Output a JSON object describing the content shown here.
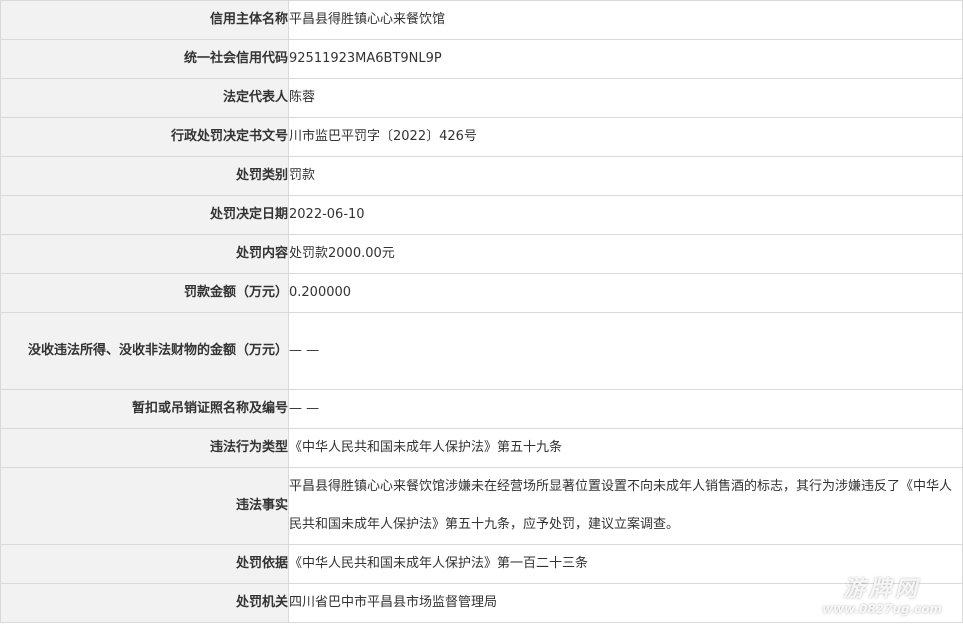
{
  "rows": [
    {
      "label": "信用主体名称",
      "value": "平昌县得胜镇心心来餐饮馆"
    },
    {
      "label": "统一社会信用代码",
      "value": "92511923MA6BT9NL9P"
    },
    {
      "label": "法定代表人",
      "value": "陈蓉"
    },
    {
      "label": "行政处罚决定书文号",
      "value": "川市监巴平罚字〔2022〕426号"
    },
    {
      "label": "处罚类别",
      "value": "罚款"
    },
    {
      "label": "处罚决定日期",
      "value": "2022-06-10"
    },
    {
      "label": "处罚内容",
      "value": "处罚款2000.00元"
    },
    {
      "label": "罚款金额（万元）",
      "value": "0.200000"
    },
    {
      "label": "没收违法所得、没收非法财物的金额（万元）",
      "value": "— —"
    },
    {
      "label": "暂扣或吊销证照名称及编号",
      "value": "— —"
    },
    {
      "label": "违法行为类型",
      "value": "《中华人民共和国未成年人保护法》第五十九条"
    },
    {
      "label": "违法事实",
      "value": "平昌县得胜镇心心来餐饮馆涉嫌未在经营场所显著位置设置不向未成年人销售酒的标志，其行为涉嫌违反了《中华人民共和国未成年人保护法》第五十九条，应予处罚，建议立案调查。"
    },
    {
      "label": "处罚依据",
      "value": "《中华人民共和国未成年人保护法》第一百二十三条"
    },
    {
      "label": "处罚机关",
      "value": "四川省巴中市平昌县市场监督管理局"
    }
  ],
  "watermark": {
    "main": "游牌网",
    "sub": "www.0827ug.com"
  }
}
